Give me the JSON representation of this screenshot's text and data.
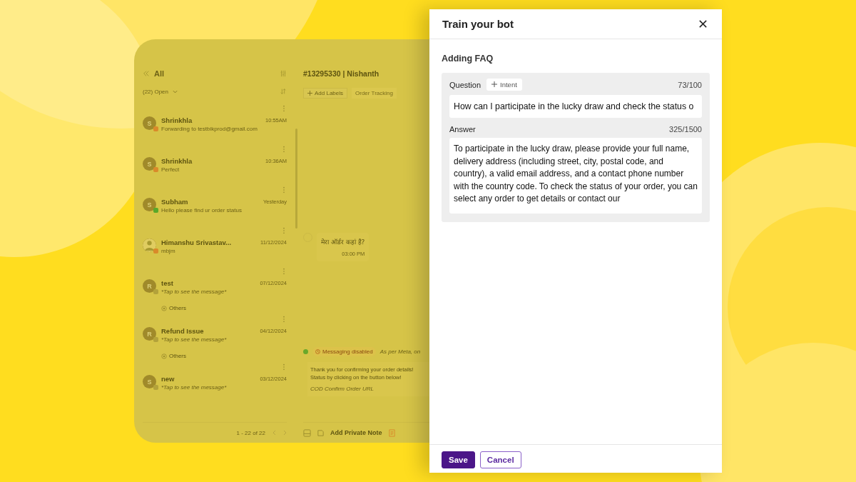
{
  "inbox": {
    "title": "All",
    "filter": "(22) Open",
    "conversations": [
      {
        "name": "Shrinkhla",
        "preview": "Forwarding to testbikprod@gmail.com",
        "time": "10:55AM",
        "avatar": "S",
        "color": "#d98a2a",
        "italic": false
      },
      {
        "name": "Shrinkhla",
        "preview": "Perfect",
        "time": "10:36AM",
        "avatar": "S",
        "color": "#d98a2a",
        "italic": false
      },
      {
        "name": "Subham",
        "preview": "Hello please find ur order status",
        "time": "Yesterday",
        "avatar": "S",
        "color": "#5aa82a",
        "italic": false
      },
      {
        "name": "Himanshu Srivastav...",
        "preview": "mbjm",
        "time": "11/12/2024",
        "color": "#d98a2a",
        "italic": false
      },
      {
        "name": "test",
        "preview": "*Tap to see the message*",
        "time": "07/12/2024",
        "avatar": "R",
        "color": "#b3a23a",
        "italic": true,
        "tag": "Others"
      },
      {
        "name": "Refund Issue",
        "preview": "*Tap to see the message*",
        "time": "04/12/2024",
        "avatar": "R",
        "color": "#b3a23a",
        "italic": true,
        "tag": "Others"
      },
      {
        "name": "new",
        "preview": "*Tap to see the message*",
        "time": "03/12/2024",
        "avatar": "S",
        "color": "#b3a23a",
        "italic": true
      }
    ],
    "pagination": "1 - 22 of 22"
  },
  "chat": {
    "title": "#13295330 | Nishanth",
    "add_labels": "Add Labels",
    "label": "Order Tracking",
    "message": {
      "text": "मेरा ऑर्डर कहां है?",
      "time": "03:00 PM"
    },
    "status": "Messaging disabled",
    "status_note": "As per Meta, on",
    "template": {
      "lines": [
        "Thank you for confirming your order details!",
        "Status by clicking on the button below!"
      ],
      "button": "COD Confirm Order URL"
    },
    "private_note": "Add Private Note"
  },
  "modal": {
    "title": "Train your bot",
    "section": "Adding FAQ",
    "question": {
      "label": "Question",
      "intent_button": "Intent",
      "count": "73/100",
      "value": "How can I participate in the lucky draw and check the status o"
    },
    "answer": {
      "label": "Answer",
      "count": "325/1500",
      "value": "To participate in the lucky draw, please provide your full name, delivery address (including street, city, postal code, and country), a valid email address, and a contact phone number with the country code. To check the status of your order, you can select any order to get details or contact our"
    },
    "buttons": [
      {
        "label": "Save",
        "kind": "primary"
      },
      {
        "label": "Cancel",
        "kind": "secondary"
      }
    ]
  }
}
